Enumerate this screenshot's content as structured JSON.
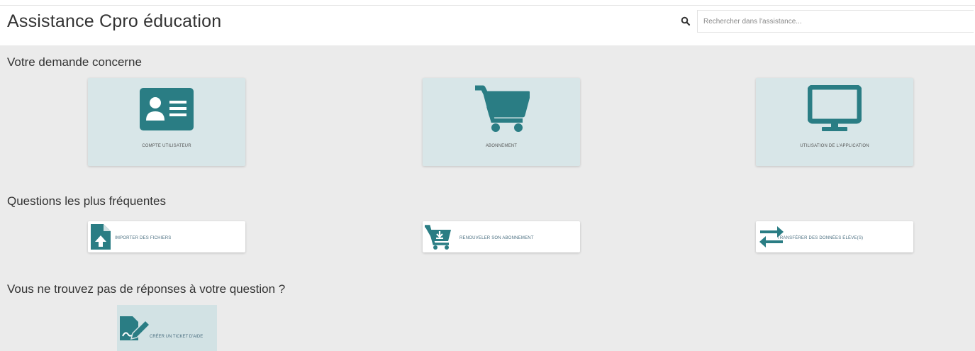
{
  "header": {
    "title": "Assistance Cpro éducation",
    "search_placeholder": "Rechercher dans l'assistance..."
  },
  "sections": {
    "request": "Votre demande concerne",
    "faq": "Questions les plus fréquentes",
    "notfound": "Vous ne trouvez pas de réponses à votre question ?"
  },
  "categories": [
    {
      "label": "COMPTE UTILISATEUR",
      "icon": "id-card-icon"
    },
    {
      "label": "ABONNEMENT",
      "icon": "shopping-cart-icon"
    },
    {
      "label": "UTILISATION DE L'APPLICATION",
      "icon": "monitor-icon"
    }
  ],
  "faq_items": [
    {
      "label": "IMPORTER DES FICHIERS",
      "icon": "file-upload-icon"
    },
    {
      "label": "RENOUVELER SON ABONNEMENT",
      "icon": "cart-download-icon"
    },
    {
      "label": "TRANSFÉRER DES DONNÉES ÉLÈVE(S)",
      "icon": "exchange-arrows-icon"
    }
  ],
  "ticket": {
    "label": "CRÉER UN TICKET D'AIDE",
    "icon": "edit-ticket-icon"
  },
  "colors": {
    "accent": "#2a7d84",
    "card_bg": "#d8e6e8",
    "page_bg": "#ebebeb"
  }
}
